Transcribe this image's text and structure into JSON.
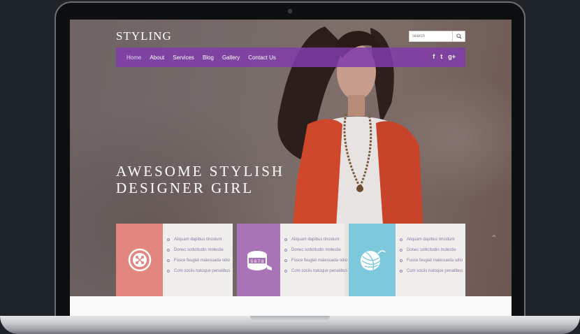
{
  "site": {
    "logo": "STYLING",
    "search_placeholder": "search",
    "nav": [
      "Home",
      "About",
      "Services",
      "Blog",
      "Gallery",
      "Contact Us"
    ],
    "social": [
      "f",
      "t",
      "g+"
    ],
    "headline_line1": "AWESOME STYLISH",
    "headline_line2": "DESIGNER GIRL"
  },
  "cards": [
    {
      "color": "#e38680",
      "icon": "button-icon",
      "items": [
        "Aliquam dapibus tincidunt",
        "Donec sollicitudin molestie",
        "Fusce feugiat malesuada odio",
        "Cum sociis natoque penatibus"
      ]
    },
    {
      "color": "#a973b7",
      "icon": "measuring-tape-icon",
      "items": [
        "Aliquam dapibus tincidunt",
        "Donec sollicitudin molestie",
        "Fusce feugiat malesuada odio",
        "Cum sociis natoque penatibus"
      ]
    },
    {
      "color": "#7ec8db",
      "icon": "yarn-ball-icon",
      "items": [
        "Aliquam dapibus tincidunt",
        "Donec sollicitudin molestie",
        "Fusce feugiat malesuada odio",
        "Cum sociis natoque penatibus"
      ]
    }
  ],
  "tape_numbers": "5 6 7 8"
}
